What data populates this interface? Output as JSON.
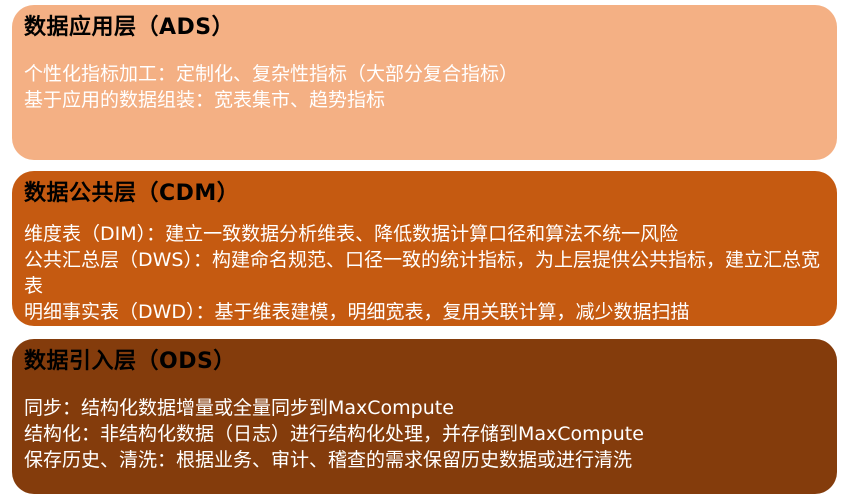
{
  "layers": [
    {
      "title": "数据应用层（ADS）",
      "items": [
        "个性化指标加工：定制化、复杂性指标（大部分复合指标）",
        "基于应用的数据组装：宽表集市、趋势指标"
      ]
    },
    {
      "title": "数据公共层（CDM）",
      "items": [
        "维度表（DIM）：建立一致数据分析维表、降低数据计算口径和算法不统一风险",
        "公共汇总层（DWS）：构建命名规范、口径一致的统计指标，为上层提供公共指标，建立汇总宽表",
        "明细事实表（DWD）：基于维表建模，明细宽表，复用关联计算，减少数据扫描"
      ]
    },
    {
      "title": "数据引入层（ODS）",
      "items": [
        "同步：结构化数据增量或全量同步到MaxCompute",
        "结构化：非结构化数据（日志）进行结构化处理，并存储到MaxCompute",
        "保存历史、清洗：根据业务、审计、稽查的需求保留历史数据或进行清洗"
      ]
    }
  ],
  "colors": {
    "ads_fill": "#f4b084",
    "cdm_fill": "#c55a11",
    "ods_fill": "#843c0c",
    "title_text": "#000000",
    "body_text": "#ffffff"
  }
}
